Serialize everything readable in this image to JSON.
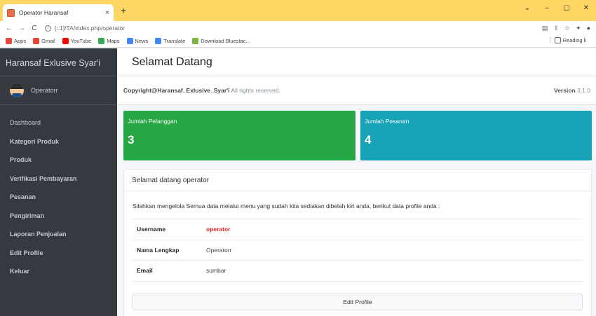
{
  "browser": {
    "tab_title": "Operator Haransaf",
    "tab_close": "×",
    "new_tab": "+",
    "url": "[::1]/TA/index.php/operator",
    "window_controls": [
      "⌄",
      "–",
      "▢",
      "✕"
    ],
    "bookmarks": [
      {
        "label": "Apps",
        "color": "#e8453c"
      },
      {
        "label": "Gmail",
        "color": "#ea4335"
      },
      {
        "label": "YouTube",
        "color": "#ff0000"
      },
      {
        "label": "Maps",
        "color": "#34a853"
      },
      {
        "label": "News",
        "color": "#4285f4"
      },
      {
        "label": "Translate",
        "color": "#4285f4"
      },
      {
        "label": "Download Bluestac...",
        "color": "#7cb342"
      }
    ],
    "reading_list": "Reading li"
  },
  "sidebar": {
    "brand": "Haransaf Exlusive Syar'i",
    "user": "Operatorr",
    "items": [
      {
        "label": "Dashboard"
      },
      {
        "label": "Kategori Produk"
      },
      {
        "label": "Produk"
      },
      {
        "label": "Verifikasi Pembayaran"
      },
      {
        "label": "Pesanan"
      },
      {
        "label": "Pengiriman"
      },
      {
        "label": "Laporan Penjualan"
      },
      {
        "label": "Edit Profile"
      },
      {
        "label": "Keluar"
      }
    ]
  },
  "header": {
    "title": "Selamat Datang"
  },
  "footer": {
    "copyright_bold": "Copyright@Haransaf_Exlusive_Syar'i",
    "copyright_rest": " All rights reserved.",
    "version_label": "Version",
    "version_value": "3.1.0"
  },
  "stats": [
    {
      "label": "Jumlah Pelanggan",
      "value": "3",
      "color": "#28a745"
    },
    {
      "label": "Jumlah Pesanan",
      "value": "4",
      "color": "#17a2b8"
    }
  ],
  "welcome": {
    "title": "Selamat datang operator",
    "text": "Silahkan mengelola Semua data melalui menu yang sudah kita sediakan dibelah kiri anda, berikut data profile anda :",
    "profile": [
      {
        "key": "Username",
        "value": "operator"
      },
      {
        "key": "Nama Lengkap",
        "value": "Operatorr"
      },
      {
        "key": "Email",
        "value": "sumbar"
      }
    ],
    "edit_button": "Edit Profile"
  }
}
